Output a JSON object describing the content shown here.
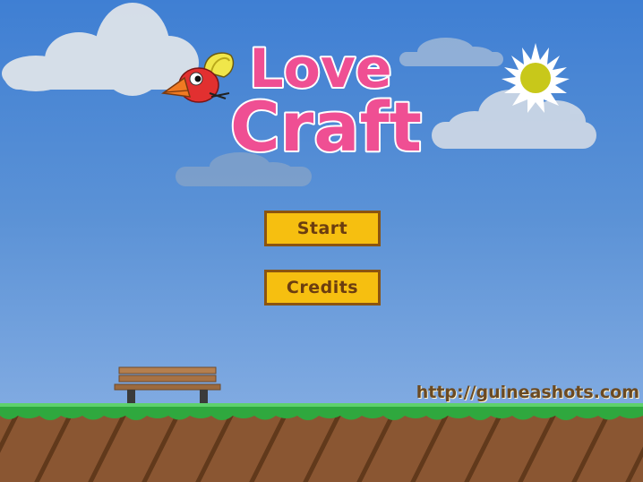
{
  "game": {
    "title_line1": "Love",
    "title_line2": "Craft"
  },
  "menu": {
    "start_label": "Start",
    "credits_label": "Credits"
  },
  "footer": {
    "site_link": "http://guineashots.com"
  },
  "colors": {
    "sky_top": "#3f7fd3",
    "sky_bottom": "#8fb4e6",
    "title_pink": "#ef4f93",
    "button_fill": "#f6bf10",
    "button_border": "#8b5410",
    "grass": "#3aa84a",
    "dirt": "#8a5632",
    "sun": "#c8c81a"
  }
}
